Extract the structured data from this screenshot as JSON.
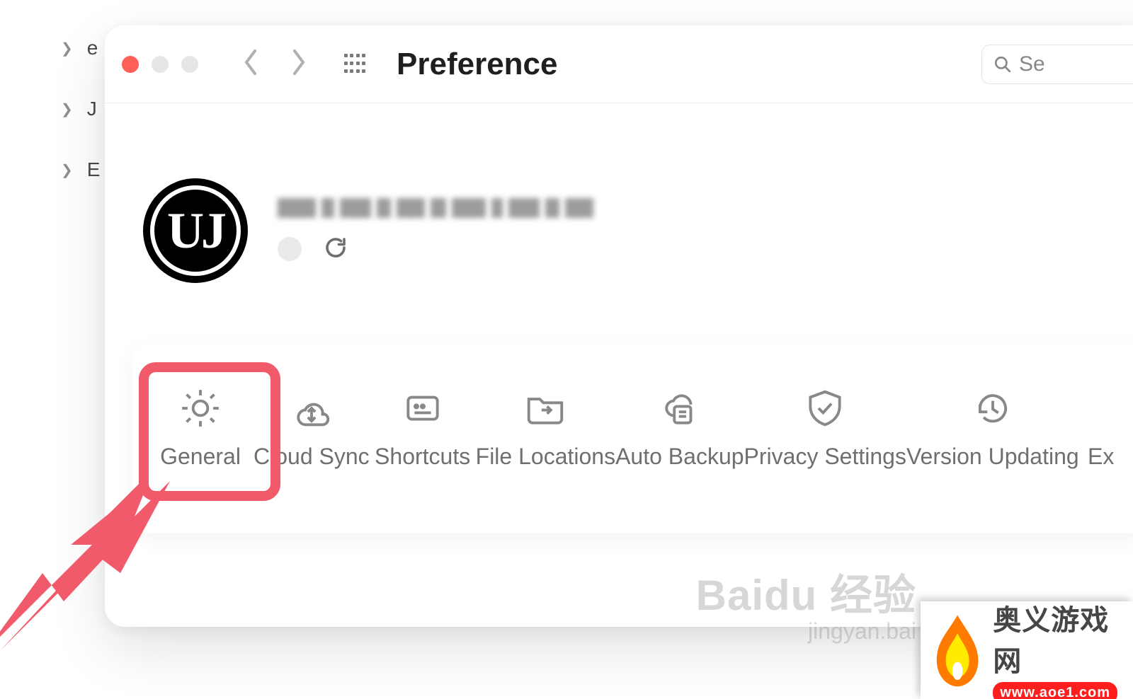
{
  "bg_items": [
    {
      "letter": "e"
    },
    {
      "letter": "J"
    },
    {
      "letter": "E"
    }
  ],
  "window": {
    "title": "Preference",
    "search_placeholder": "Se"
  },
  "tabs": [
    {
      "id": "general",
      "label": "General"
    },
    {
      "id": "cloud-sync",
      "label": "Cloud Sync"
    },
    {
      "id": "shortcuts",
      "label": "Shortcuts"
    },
    {
      "id": "file-locations",
      "label": "File Locations"
    },
    {
      "id": "auto-backup",
      "label": "Auto Backup"
    },
    {
      "id": "privacy",
      "label": "Privacy Settings"
    },
    {
      "id": "version",
      "label": "Version Updating"
    },
    {
      "id": "extra",
      "label": "Ex"
    }
  ],
  "watermark": {
    "brand": "Baidu 经验",
    "sub": "jingyan.bai"
  },
  "badge": {
    "cn": "奥义游戏网",
    "url": "www.aoe1.com"
  }
}
